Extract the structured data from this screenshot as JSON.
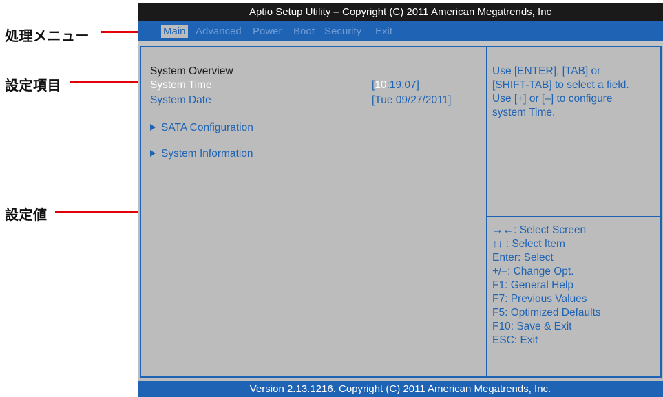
{
  "callouts": {
    "menu": "処理メニュー",
    "item": "設定項目",
    "value": "設定値"
  },
  "title_bar": "Aptio Setup Utility – Copyright (C) 2011 American Megatrends, Inc",
  "menu": [
    {
      "label": "Main",
      "active": true
    },
    {
      "label": "Advanced",
      "active": false
    },
    {
      "label": "Power",
      "active": false
    },
    {
      "label": "Boot",
      "active": false
    },
    {
      "label": "Security",
      "active": false
    },
    {
      "label": "Exit",
      "active": false
    }
  ],
  "main": {
    "section_label": "System Overview",
    "system_time_label": "System Time",
    "system_time_value_highlight": "10",
    "system_time_value_rest": ":19:07]",
    "bracket_open": "[",
    "system_date_label": "System Date",
    "system_date_value": "[Tue 09/27/2011]",
    "submenus": [
      {
        "label": "SATA Configuration"
      },
      {
        "label": "System Information"
      }
    ]
  },
  "help": {
    "lines": [
      "Use [ENTER], [TAB] or",
      "[SHIFT-TAB] to select a field.",
      "Use [+] or [–] to configure",
      "system Time."
    ]
  },
  "keys": [
    "→←: Select Screen",
    "↑↓ : Select Item",
    "Enter: Select",
    "+/–: Change Opt.",
    "F1: General Help",
    "F7: Previous Values",
    "F5: Optimized Defaults",
    "F10: Save & Exit",
    "ESC: Exit"
  ],
  "footer": "Version 2.13.1216. Copyright (C) 2011 American Megatrends, Inc.",
  "colors": {
    "accent": "#1f64b4",
    "background": "#bcbcbc",
    "callout_line": "#e3000b"
  }
}
